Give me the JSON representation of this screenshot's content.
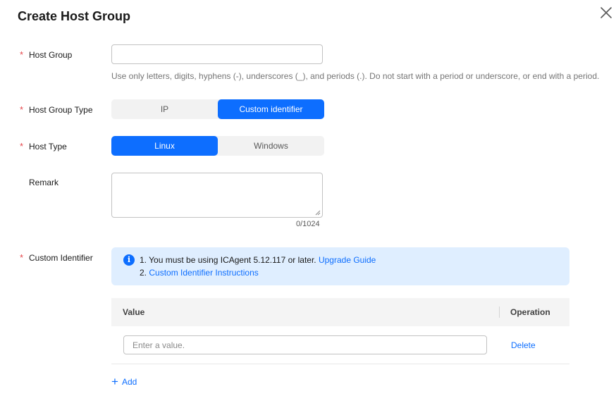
{
  "dialog": {
    "title": "Create Host Group"
  },
  "form": {
    "host_group": {
      "label": "Host Group",
      "value": "",
      "hint": "Use only letters, digits, hyphens (-), underscores (_), and periods (.). Do not start with a period or underscore, or end with a period."
    },
    "host_group_type": {
      "label": "Host Group Type",
      "options": [
        "IP",
        "Custom identifier"
      ],
      "selected": "Custom identifier"
    },
    "host_type": {
      "label": "Host Type",
      "options": [
        "Linux",
        "Windows"
      ],
      "selected": "Linux"
    },
    "remark": {
      "label": "Remark",
      "value": "",
      "counter": "0/1024"
    },
    "custom_identifier": {
      "label": "Custom Identifier",
      "notice": {
        "line1_text": "1. You must be using ICAgent 5.12.117 or later.",
        "line1_link": "Upgrade Guide",
        "line2_prefix": "2.",
        "line2_link": "Custom Identifier Instructions"
      },
      "table": {
        "columns": [
          "Value",
          "Operation"
        ],
        "rows": [
          {
            "value": "",
            "placeholder": "Enter a value.",
            "action": "Delete"
          }
        ]
      },
      "add_label": "Add"
    }
  },
  "colors": {
    "accent": "#0d6eff",
    "required": "#e5484d",
    "notice_bg": "#dfeeff"
  }
}
